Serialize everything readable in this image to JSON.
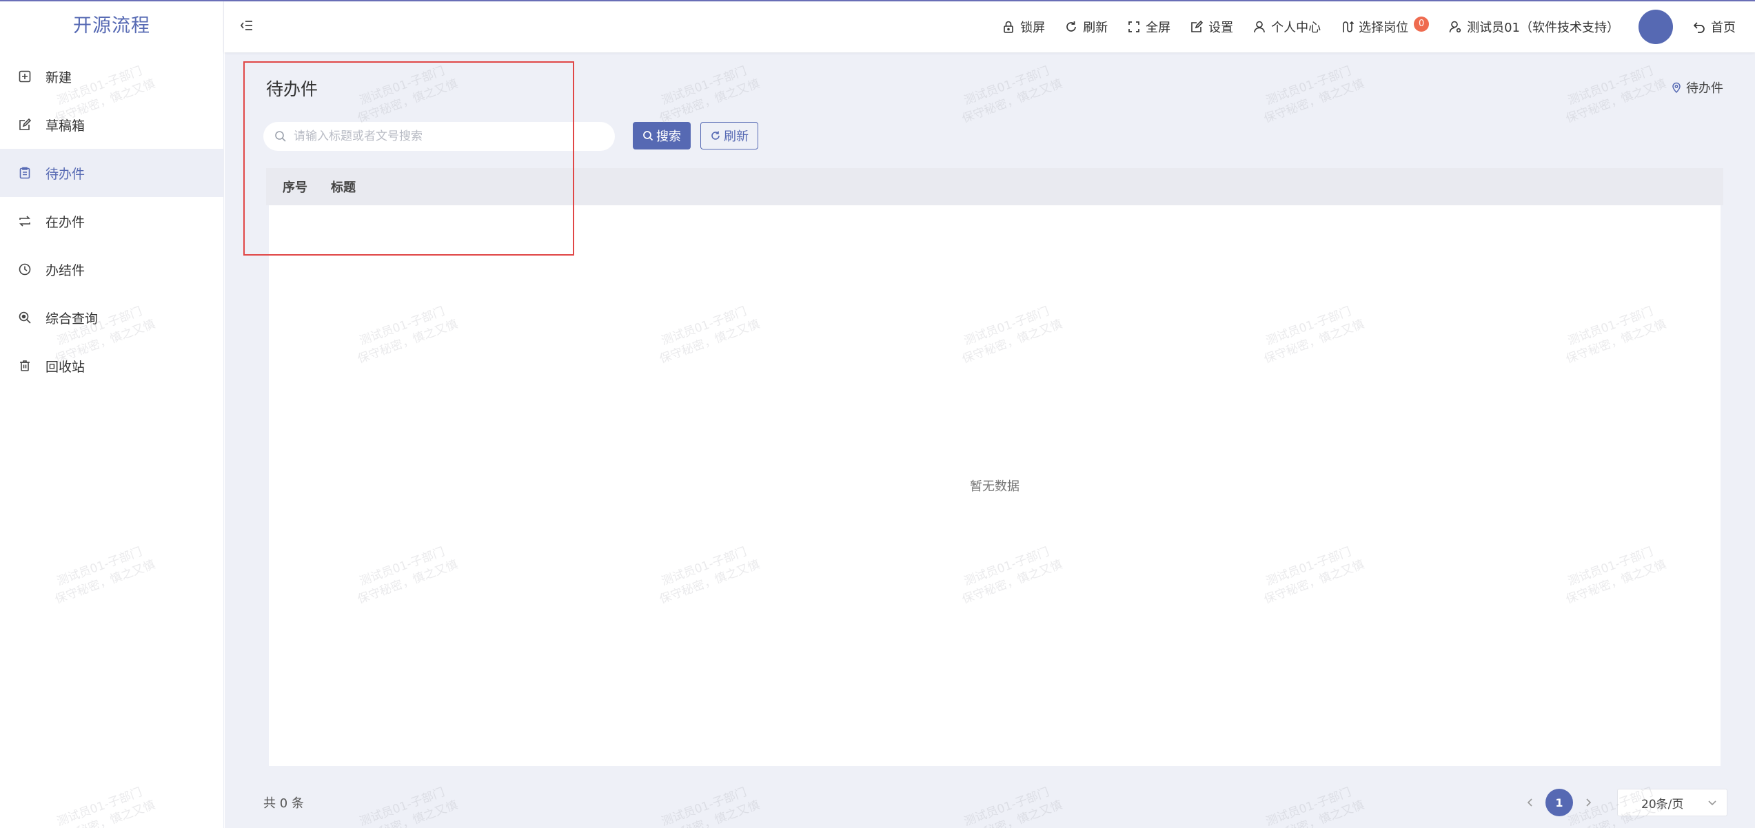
{
  "app": {
    "logo_text": "开源流程"
  },
  "sidebar": {
    "items": [
      {
        "label": "新建",
        "icon": "plus-square-icon"
      },
      {
        "label": "草稿箱",
        "icon": "edit-square-icon"
      },
      {
        "label": "待办件",
        "icon": "clipboard-icon",
        "active": true
      },
      {
        "label": "在办件",
        "icon": "repeat-icon"
      },
      {
        "label": "办结件",
        "icon": "clock-icon"
      },
      {
        "label": "综合查询",
        "icon": "zoom-search-icon"
      },
      {
        "label": "回收站",
        "icon": "trash-icon"
      }
    ]
  },
  "header": {
    "lock_label": "锁屏",
    "refresh_label": "刷新",
    "fullscreen_label": "全屏",
    "settings_label": "设置",
    "profile_label": "个人中心",
    "position_label": "选择岗位",
    "position_badge": "0",
    "user_label": "测试员01（软件技术支持）",
    "home_label": "首页",
    "accent_color": "#5669b3",
    "badge_color": "#ef6b4f"
  },
  "main": {
    "page_title": "待办件",
    "breadcrumb": "待办件",
    "search": {
      "placeholder": "请输入标题或者文号搜索",
      "value": ""
    },
    "search_button": "搜索",
    "refresh_button": "刷新",
    "table": {
      "columns": [
        "序号",
        "标题"
      ],
      "rows": [],
      "empty_text": "暂无数据"
    },
    "footer": {
      "total_text": "共 0 条",
      "current_page": "1",
      "page_size": "20条/页"
    }
  },
  "watermark": {
    "line1": "测试员01-子部门",
    "line2": "保守秘密，慎之又慎"
  }
}
